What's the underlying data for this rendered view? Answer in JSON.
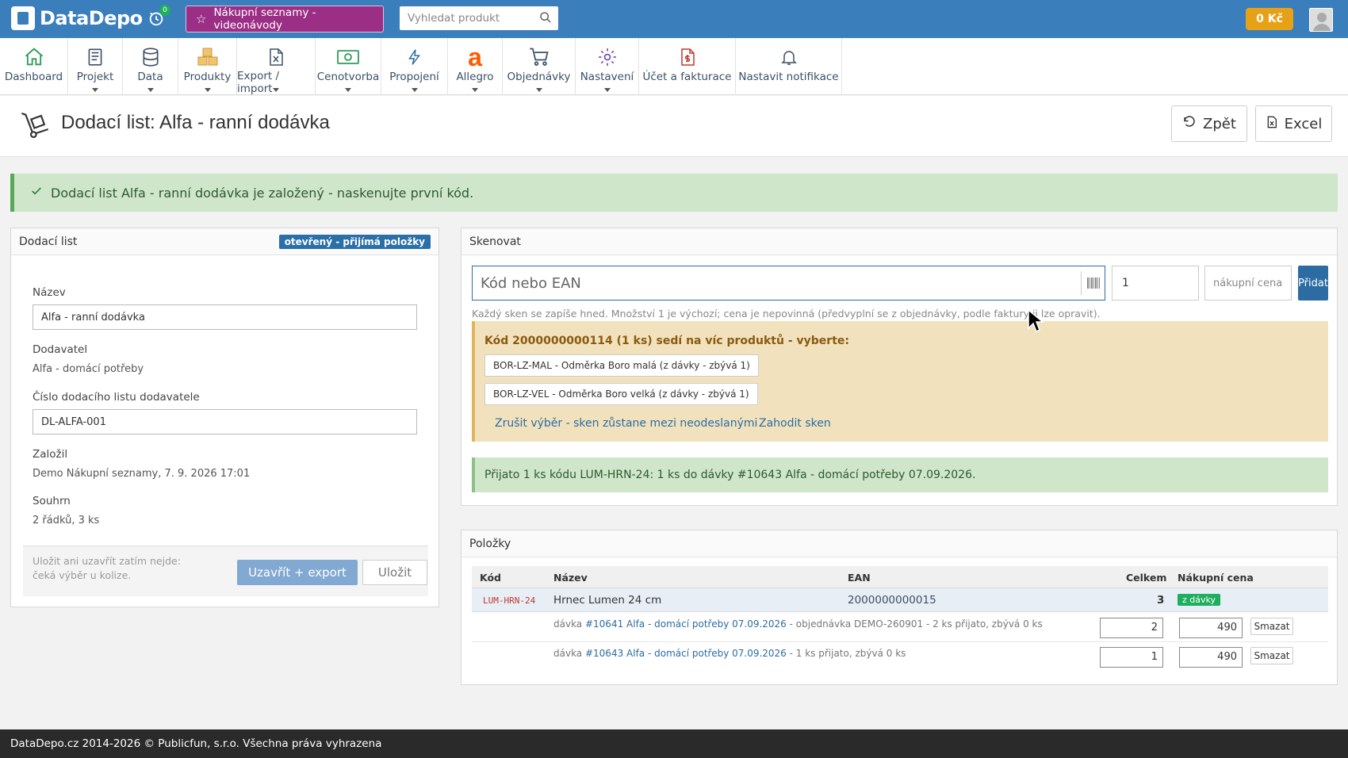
{
  "topbar": {
    "logo": "DataDepo",
    "history_badge": "0",
    "promo_label": "Nákupní seznamy - videonávody",
    "search_placeholder": "Vyhledat produkt",
    "credit": "0 Kč"
  },
  "nav": [
    {
      "label": "Dashboard",
      "icon": "home-icon",
      "caret": false
    },
    {
      "label": "Projekt",
      "icon": "book-icon",
      "caret": true
    },
    {
      "label": "Data",
      "icon": "database-icon",
      "caret": true
    },
    {
      "label": "Produkty",
      "icon": "boxes-icon",
      "caret": true
    },
    {
      "label": "Export / import",
      "icon": "excel-file-icon",
      "caret": true
    },
    {
      "label": "Cenotvorba",
      "icon": "money-icon",
      "caret": true
    },
    {
      "label": "Propojení",
      "icon": "lightning-icon",
      "caret": true
    },
    {
      "label": "Allegro",
      "icon": "allegro-icon",
      "caret": true
    },
    {
      "label": "Objednávky",
      "icon": "cart-icon",
      "caret": true
    },
    {
      "label": "Nastavení",
      "icon": "gear-icon",
      "caret": true
    },
    {
      "label": "Účet a fakturace",
      "icon": "invoice-icon",
      "caret": false
    },
    {
      "label": "Nastavit notifikace",
      "icon": "bell-icon",
      "caret": false
    }
  ],
  "page": {
    "title": "Dodací list: Alfa - ranní dodávka",
    "back_label": "Zpět",
    "excel_label": "Excel"
  },
  "success_alert": "Dodací list Alfa - ranní dodávka je založený - naskenujte první kód.",
  "left_panel": {
    "heading": "Dodací list",
    "status_badge": "otevřený - přijímá položky",
    "name_label": "Název",
    "name_value": "Alfa - ranní dodávka",
    "supplier_label": "Dodavatel",
    "supplier_value": "Alfa - domácí potřeby",
    "doc_number_label": "Číslo dodacího listu dodavatele",
    "doc_number_value": "DL-ALFA-001",
    "created_label": "Založil",
    "created_value": "Demo Nákupní seznamy, 7. 9. 2026 17:01",
    "summary_label": "Souhrn",
    "summary_value": "2 řádků, 3 ks",
    "footer_note": "Uložit ani uzavřít zatím nejde: čeká výběr u kolize.",
    "close_export_label": "Uzavřít + export",
    "save_label": "Uložit"
  },
  "scan_panel": {
    "heading": "Skenovat",
    "code_placeholder": "Kód nebo EAN",
    "qty_value": "1",
    "price_placeholder": "nákupní cena",
    "add_label": "Přidat",
    "hint": "Každý sken se zapíše hned. Množství 1 je výchozí; cena je nepovinná (předvyplní se z objednávky, podle faktury ji lze opravit).",
    "warning_title": "Kód 2000000000114 (1 ks) sedí na víc produktů - vyberte:",
    "choices": [
      "BOR-LZ-MAL - Odměrka Boro malá (z dávky - zbývá 1)",
      "BOR-LZ-VEL - Odměrka Boro velká (z dávky - zbývá 1)"
    ],
    "cancel_link": "Zrušit výběr - sken zůstane mezi neodeslanými",
    "discard_link": "Zahodit sken",
    "received_info": "Přijato 1 ks kódu LUM-HRN-24: 1 ks do dávky #10643 Alfa - domácí potřeby 07.09.2026."
  },
  "items_panel": {
    "heading": "Položky",
    "columns": {
      "code": "Kód",
      "name": "Název",
      "ean": "EAN",
      "total": "Celkem",
      "price": "Nákupní cena"
    },
    "row": {
      "code": "LUM-HRN-24",
      "name": "Hrnec Lumen 24 cm",
      "ean": "2000000000015",
      "total": "3",
      "tag": "z dávky"
    },
    "batches": [
      {
        "prefix": "dávka ",
        "link": "#10641 Alfa - domácí potřeby 07.09.2026",
        "suffix": " - objednávka DEMO-260901 - 2 ks přijato, zbývá 0 ks",
        "qty": "2",
        "price": "490",
        "delete": "Smazat"
      },
      {
        "prefix": "dávka ",
        "link": "#10643 Alfa - domácí potřeby 07.09.2026",
        "suffix": " - 1 ks přijato, zbývá 0 ks",
        "qty": "1",
        "price": "490",
        "delete": "Smazat"
      }
    ]
  },
  "footer": "DataDepo.cz 2014-2026 © Publicfun, s.r.o. Všechna práva vyhrazena"
}
